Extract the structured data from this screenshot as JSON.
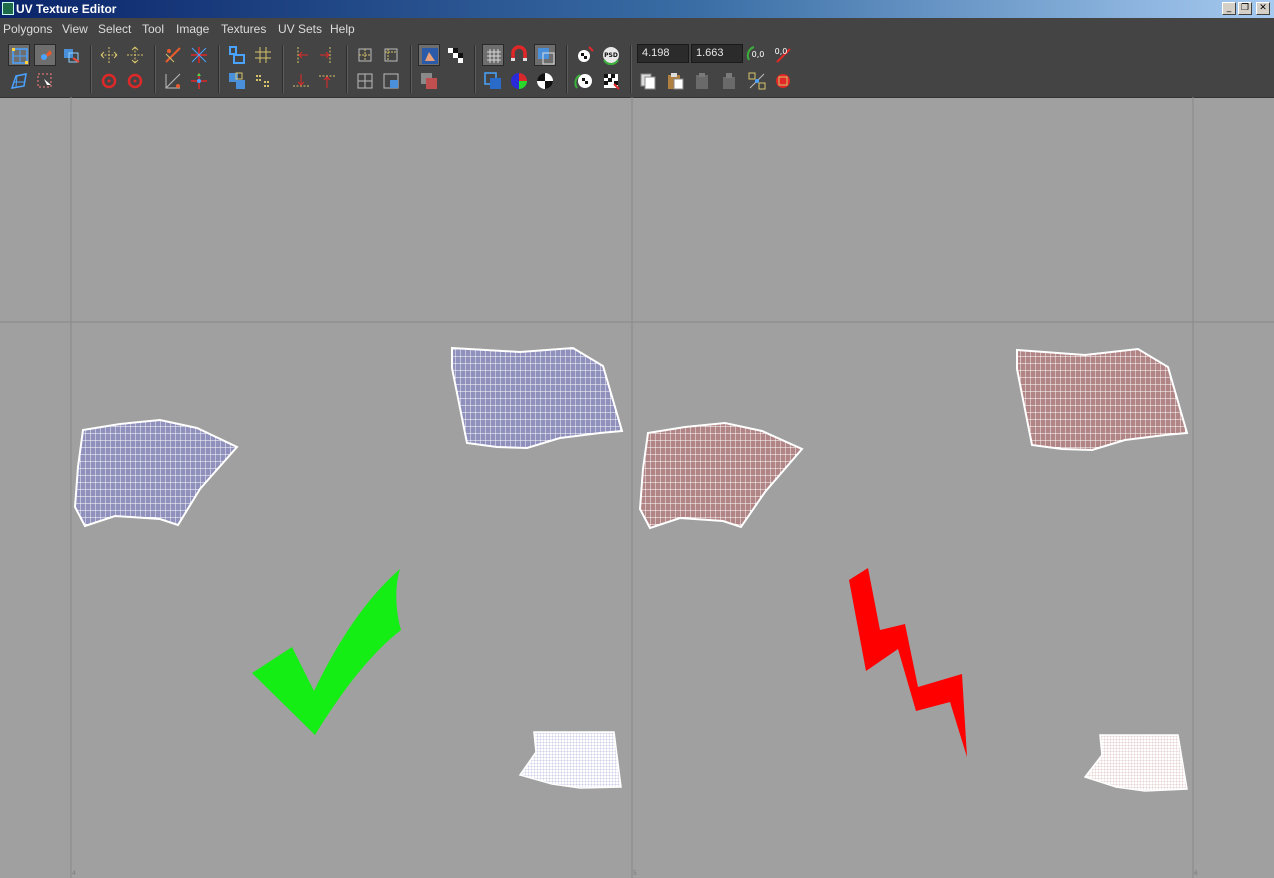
{
  "window": {
    "title": "UV Texture Editor",
    "controls": [
      "minimize",
      "restore",
      "close"
    ]
  },
  "menubar": {
    "items": [
      "Polygons",
      "View",
      "Select",
      "Tool",
      "Image",
      "Textures",
      "UV Sets",
      "Help"
    ]
  },
  "toolbar": {
    "u_value": "4.198",
    "v_value": "1.663",
    "zero_u_label": "0,0",
    "zero_v_label": "0,0",
    "psd_label": "PSD"
  },
  "viewport": {
    "uv_shells": [
      {
        "panel": "left",
        "shell": "large",
        "color": "#8f90bb"
      },
      {
        "panel": "left",
        "shell": "medium",
        "color": "#8f90bb"
      },
      {
        "panel": "left",
        "shell": "small",
        "color": "#ffffff"
      },
      {
        "panel": "right",
        "shell": "large",
        "color": "#b18585"
      },
      {
        "panel": "right",
        "shell": "medium",
        "color": "#b18585"
      },
      {
        "panel": "right",
        "shell": "small",
        "color": "#ffffff"
      }
    ],
    "annotations": [
      {
        "name": "checkmark",
        "color": "#15ee15"
      },
      {
        "name": "lightning-bolt",
        "color": "#ff0000"
      }
    ],
    "grid_line_color": "#898989",
    "background_color": "#a0a0a0",
    "tick_labels": [
      "4",
      "5",
      "6"
    ]
  }
}
